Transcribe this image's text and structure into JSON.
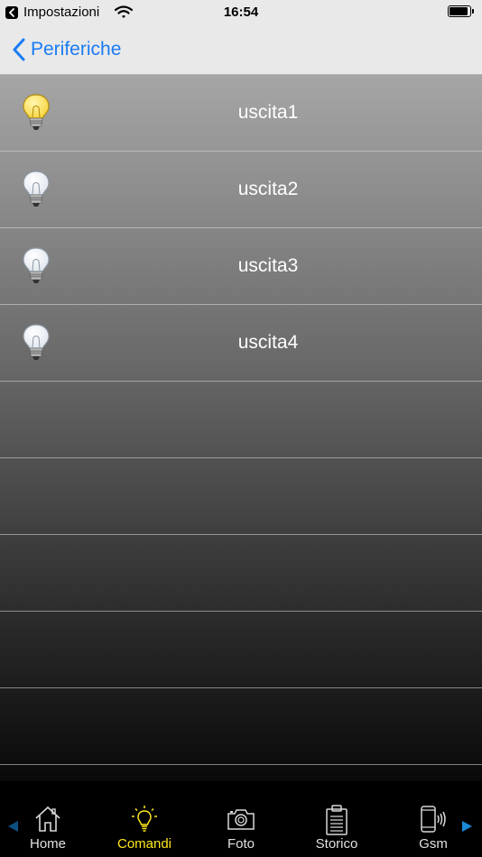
{
  "status_bar": {
    "back_app": "Impostazioni",
    "time": "16:54",
    "battery_level": 0.9
  },
  "nav": {
    "back_label": "Periferiche",
    "accent_color": "#1a7cf5"
  },
  "outputs": [
    {
      "label": "uscita1",
      "state": "on"
    },
    {
      "label": "uscita2",
      "state": "off"
    },
    {
      "label": "uscita3",
      "state": "off"
    },
    {
      "label": "uscita4",
      "state": "off"
    }
  ],
  "empty_rows": 5,
  "tabbar": {
    "active_color": "#ffe81a",
    "tabs": [
      {
        "label": "Home",
        "icon": "home-icon"
      },
      {
        "label": "Comandi",
        "icon": "lightbulb-icon",
        "active": true
      },
      {
        "label": "Foto",
        "icon": "camera-icon"
      },
      {
        "label": "Storico",
        "icon": "clipboard-icon"
      },
      {
        "label": "Gsm",
        "icon": "phone-signal-icon"
      }
    ]
  }
}
